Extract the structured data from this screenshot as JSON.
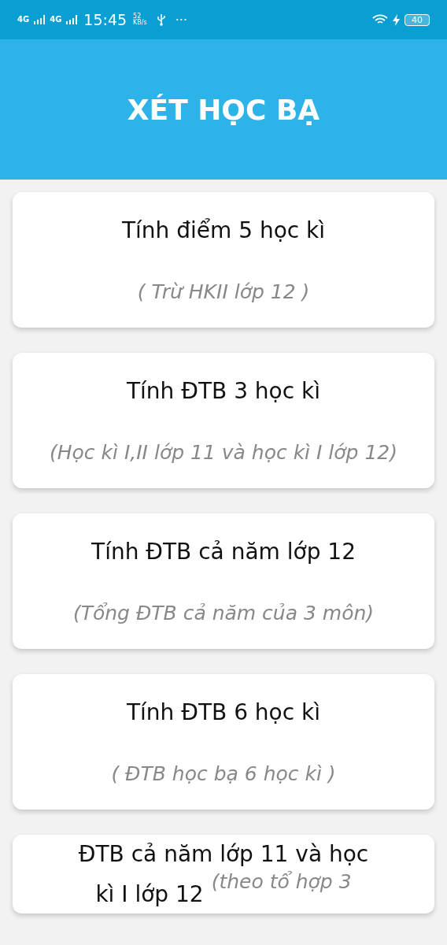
{
  "status_bar": {
    "networks": [
      "4G",
      "4G"
    ],
    "time": "15:45",
    "speed": "52",
    "speed_unit": "KB/s",
    "more": "···",
    "battery": "40"
  },
  "header": {
    "title": "XÉT HỌC BẠ"
  },
  "cards": [
    {
      "kind": "stacked",
      "title": "Tính điểm 5 học kì",
      "subtitle": "( Trừ HKII lớp 12 )"
    },
    {
      "kind": "stacked",
      "title": "Tính ĐTB 3 học kì",
      "subtitle": "(Học kì I,II lớp 11 và học kì I lớp 12)"
    },
    {
      "kind": "stacked",
      "title": "Tính ĐTB cả năm lớp 12",
      "subtitle": "(Tổng ĐTB cả năm của 3 môn)"
    },
    {
      "kind": "stacked",
      "title": "Tính ĐTB 6 học kì",
      "subtitle": "( ĐTB học bạ 6 học kì )"
    },
    {
      "kind": "inline",
      "title_lines": [
        "ĐTB cả năm lớp 11 và học",
        "kì I lớp 12"
      ],
      "subtitle": "(theo tổ hợp 3"
    }
  ]
}
